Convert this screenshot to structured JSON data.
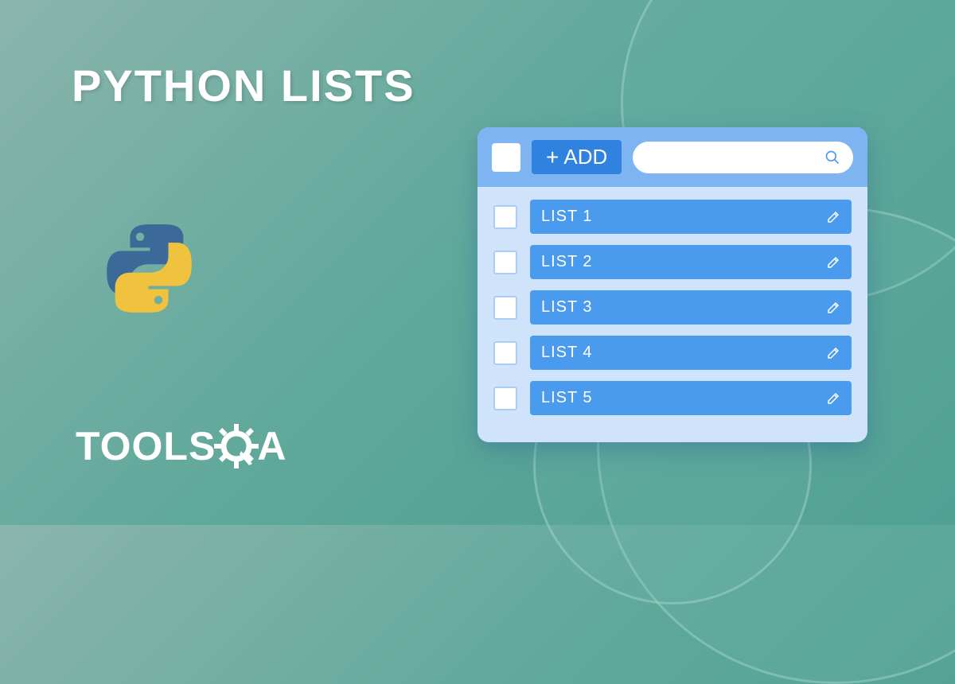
{
  "title": "PYTHON LISTS",
  "brand": {
    "text": "TOOLSQA"
  },
  "panel": {
    "add_label": "ADD",
    "search_placeholder": "",
    "items": [
      {
        "label": "LIST 1"
      },
      {
        "label": "LIST 2"
      },
      {
        "label": "LIST 3"
      },
      {
        "label": "LIST 4"
      },
      {
        "label": "LIST 5"
      }
    ]
  },
  "colors": {
    "panel_bg": "#cfe4fb",
    "header_bg": "#7db4f1",
    "button_bg": "#2f82e0",
    "row_bg": "#4a9aee"
  }
}
